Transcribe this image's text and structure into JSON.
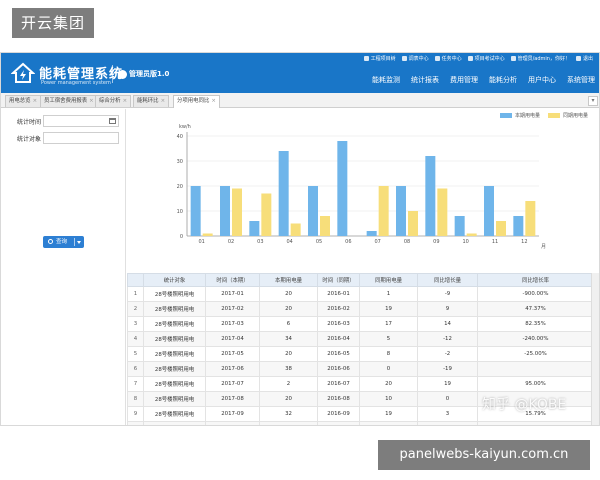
{
  "corner_badge": "开云集团",
  "site_badge": "panelwebs-kaiyun.com.cn",
  "watermark": "知乎 @KOBE",
  "app": {
    "title": "能耗管理系统",
    "subtitle": "Power management system",
    "version": "管理员版1.0",
    "top_links": [
      "工程项目树",
      "调表中心",
      "任务中心",
      "项目考试中心",
      "管理员/admin，你好！",
      "退出"
    ],
    "main_nav": [
      "能耗监测",
      "统计报表",
      "费用管理",
      "能耗分析",
      "用户中心",
      "系统管理"
    ]
  },
  "tabs": [
    {
      "label": "用电总览",
      "active": false
    },
    {
      "label": "员工宿舍费用报表",
      "active": false
    },
    {
      "label": "综合分析",
      "active": false
    },
    {
      "label": "能耗环比",
      "active": false
    },
    {
      "label": "分项用电同比",
      "active": true
    }
  ],
  "form": {
    "time_label": "统计时间",
    "object_label": "统计对象",
    "time_value": "",
    "object_value": "",
    "query_button": "查询"
  },
  "chart_data": {
    "type": "bar",
    "ylabel": "kw/h",
    "xlabel": "月",
    "ylim": [
      0,
      40
    ],
    "yticks": [
      0,
      10,
      20,
      30,
      40
    ],
    "categories": [
      "01",
      "02",
      "03",
      "04",
      "05",
      "06",
      "07",
      "08",
      "09",
      "10",
      "11",
      "12"
    ],
    "series": [
      {
        "name": "本期用电量",
        "color": "#6fb5ea",
        "values": [
          20,
          20,
          6,
          34,
          20,
          38,
          2,
          20,
          32,
          8,
          20,
          8
        ]
      },
      {
        "name": "同期用电量",
        "color": "#f7de7a",
        "values": [
          1,
          19,
          17,
          5,
          8,
          0,
          20,
          10,
          19,
          1,
          6,
          14
        ]
      }
    ],
    "legend_position": "top-right",
    "grid": true
  },
  "table": {
    "columns": [
      "",
      "统计对象",
      "时间（本期）",
      "本期用电量",
      "时间（同期）",
      "同期用电量",
      "同比增长量",
      "同比增长率"
    ],
    "rows": [
      [
        "1",
        "28号楼照明用电",
        "2017-01",
        "20",
        "2016-01",
        "1",
        "-9",
        "-900.00%"
      ],
      [
        "2",
        "28号楼照明用电",
        "2017-02",
        "20",
        "2016-02",
        "19",
        "9",
        "47.37%"
      ],
      [
        "3",
        "28号楼照明用电",
        "2017-03",
        "6",
        "2016-03",
        "17",
        "14",
        "82.35%"
      ],
      [
        "4",
        "28号楼照明用电",
        "2017-04",
        "34",
        "2016-04",
        "5",
        "-12",
        "-240.00%"
      ],
      [
        "5",
        "28号楼照明用电",
        "2017-05",
        "20",
        "2016-05",
        "8",
        "-2",
        "-25.00%"
      ],
      [
        "6",
        "28号楼照明用电",
        "2017-06",
        "38",
        "2016-06",
        "0",
        "-19",
        ""
      ],
      [
        "7",
        "28号楼照明用电",
        "2017-07",
        "2",
        "2016-07",
        "20",
        "19",
        "95.00%"
      ],
      [
        "8",
        "28号楼照明用电",
        "2017-08",
        "20",
        "2016-08",
        "10",
        "0",
        ""
      ],
      [
        "9",
        "28号楼照明用电",
        "2017-09",
        "32",
        "2016-09",
        "19",
        "3",
        "15.79%"
      ],
      [
        "",
        "",
        "",
        "",
        "",
        "",
        "",
        ""
      ]
    ]
  }
}
